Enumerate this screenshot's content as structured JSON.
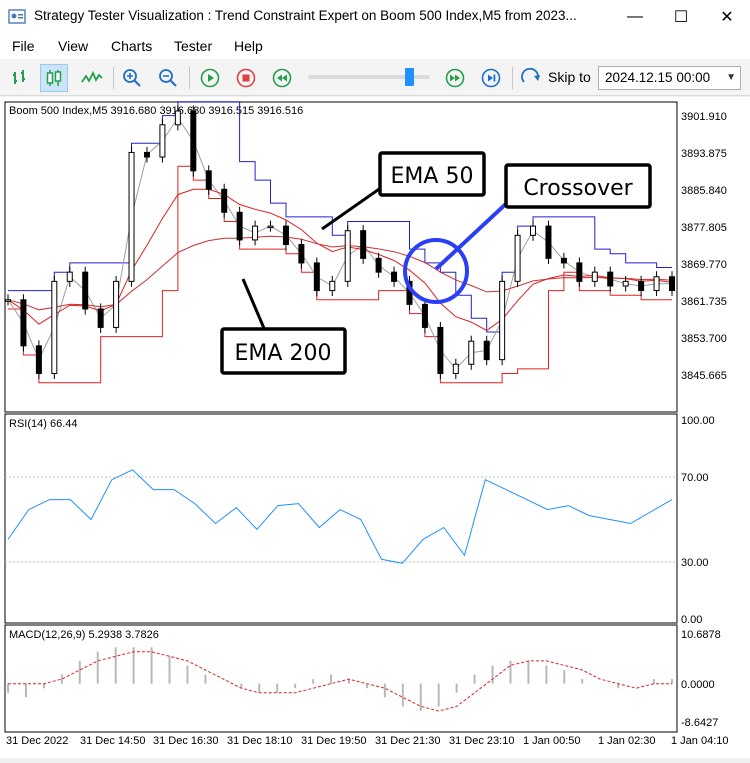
{
  "window": {
    "title": "Strategy Tester Visualization : Trend Constraint Expert on Boom 500 Index,M5 from 2023...",
    "minimize": "—",
    "maximize": "☐",
    "close": "✕"
  },
  "menu": [
    "File",
    "View",
    "Charts",
    "Tester",
    "Help"
  ],
  "toolbar": {
    "skip_label": "Skip to",
    "skip_date": "2024.12.15 00:00",
    "icons": [
      "bar-chart-icon",
      "candlestick-icon",
      "line-chart-icon",
      "zoom-in-icon",
      "zoom-out-icon",
      "play-icon",
      "stop-icon",
      "rewind-icon",
      "fast-forward-icon",
      "skip-end-icon",
      "skip-to-icon"
    ],
    "accent_blue": "#1e90ff",
    "accent_green": "#23a04a",
    "accent_red": "#e04040"
  },
  "main_chart": {
    "header": "Boom 500 Index,M5  3916.680 3916.680 3916.515 3916.516",
    "price_ticks": [
      "3901.910",
      "3893.875",
      "3885.840",
      "3877.805",
      "3869.770",
      "3861.735",
      "3853.700",
      "3845.665"
    ],
    "annotations": {
      "ema50": "EMA 50",
      "ema200": "EMA 200",
      "crossover": "Crossover"
    }
  },
  "rsi": {
    "header": "RSI(14) 66.44",
    "ticks": [
      "100.00",
      "70.00",
      "30.00",
      "0.00"
    ]
  },
  "macd": {
    "header": "MACD(12,26,9) 5.2938 3.7826",
    "ticks": [
      "10.6878",
      "0.0000",
      "-8.6427"
    ]
  },
  "time_axis": [
    "31 Dec 2022",
    "31 Dec 14:50",
    "31 Dec 16:30",
    "31 Dec 18:10",
    "31 Dec 19:50",
    "31 Dec 21:30",
    "31 Dec 23:10",
    "1 Jan 00:50",
    "1 Jan 02:30",
    "1 Jan 04:10"
  ],
  "chart_data": {
    "type": "line",
    "price_close": [
      3862,
      3852,
      3846,
      3866,
      3868,
      3860,
      3856,
      3866,
      3894,
      3893,
      3900,
      3903,
      3890,
      3886,
      3881,
      3875,
      3878,
      3878,
      3874,
      3870,
      3864,
      3866,
      3877,
      3871,
      3868,
      3866,
      3861,
      3856,
      3846,
      3848,
      3853,
      3849,
      3866,
      3876,
      3878,
      3871,
      3870,
      3866,
      3868,
      3865,
      3866,
      3864,
      3867,
      3864
    ],
    "rsi_values": [
      40,
      55,
      60,
      60,
      50,
      70,
      75,
      65,
      65,
      58,
      48,
      56,
      45,
      57,
      58,
      46,
      55,
      50,
      30,
      28,
      40,
      46,
      32,
      70,
      65,
      60,
      55,
      57,
      52,
      50,
      48,
      54,
      60
    ],
    "macd_histogram": [
      -2,
      -3,
      -1,
      2,
      5,
      7,
      8,
      8,
      8,
      6,
      4,
      2,
      0,
      -1,
      -2,
      -2,
      -1,
      1,
      2,
      1,
      -1,
      -3,
      -5,
      -6,
      -5,
      -2,
      2,
      4,
      5,
      5,
      4,
      3,
      1,
      0,
      -1,
      0,
      1,
      1
    ],
    "macd_signal": [
      0,
      0,
      0,
      1,
      3,
      5,
      6,
      7,
      7,
      6,
      5,
      3,
      1,
      -1,
      -2,
      -2,
      -2,
      -1,
      0,
      1,
      0,
      -1,
      -3,
      -5,
      -6,
      -5,
      -2,
      1,
      4,
      5,
      5,
      4,
      3,
      1,
      0,
      -1,
      0,
      0
    ]
  }
}
